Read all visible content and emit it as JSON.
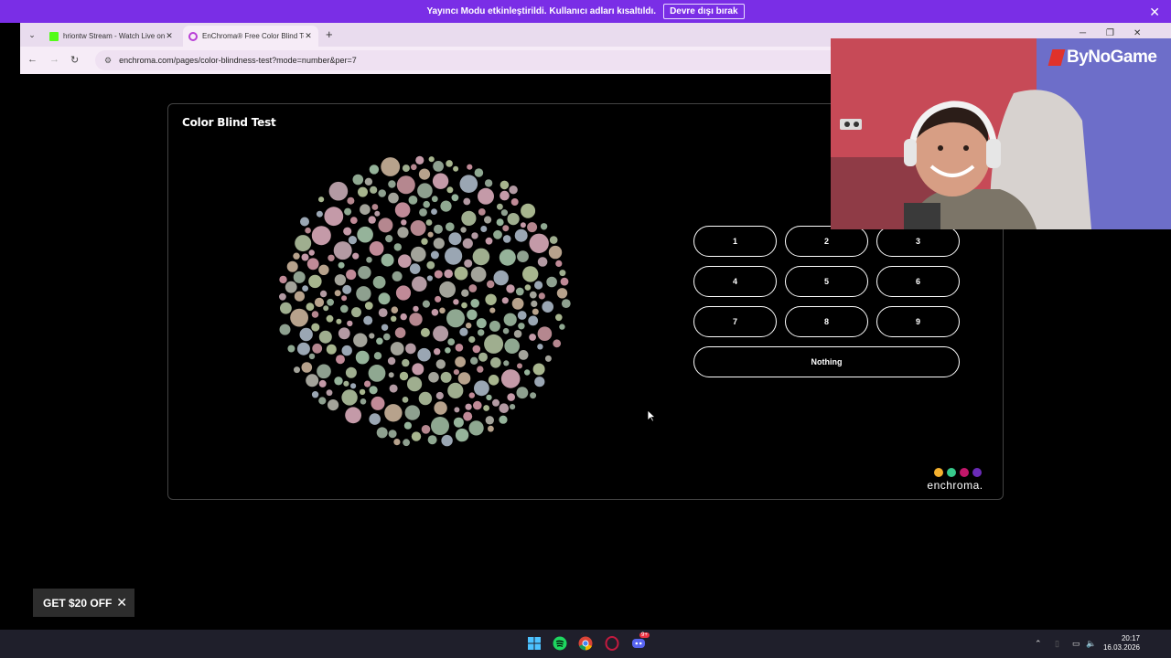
{
  "banner": {
    "message": "Yayıncı Modu etkinleştirildi. Kullanıcı adları kısaltıldı.",
    "button_label": "Devre dışı bırak",
    "close_glyph": "✕"
  },
  "browser": {
    "tabs": [
      {
        "title": "hriontw Stream - Watch Live on",
        "icon": "kick-icon",
        "close": "✕"
      },
      {
        "title": "EnChroma® Free Color Blind Te",
        "icon": "enchroma-icon",
        "close": "✕"
      }
    ],
    "new_tab": "+",
    "tab_menu": "⌄",
    "url": "enchroma.com/pages/color-blindness-test?mode=number&per=7",
    "window_controls": {
      "minimize": "─",
      "maximize": "❐",
      "close": "✕"
    }
  },
  "page": {
    "title": "Color Blind Test",
    "options": [
      "1",
      "2",
      "3",
      "4",
      "5",
      "6",
      "7",
      "8",
      "9"
    ],
    "nothing_label": "Nothing",
    "logo_text": "enchroma.",
    "logo_colors": [
      "#f5b12f",
      "#37c98b",
      "#c2176a",
      "#6a2bb8"
    ]
  },
  "overlay": {
    "brand": "ByNoGame"
  },
  "promo": {
    "label": "GET $20 OFF",
    "close": "✕"
  },
  "taskbar": {
    "time": "20:17",
    "date": "16.03.2026",
    "badge": "9+"
  }
}
